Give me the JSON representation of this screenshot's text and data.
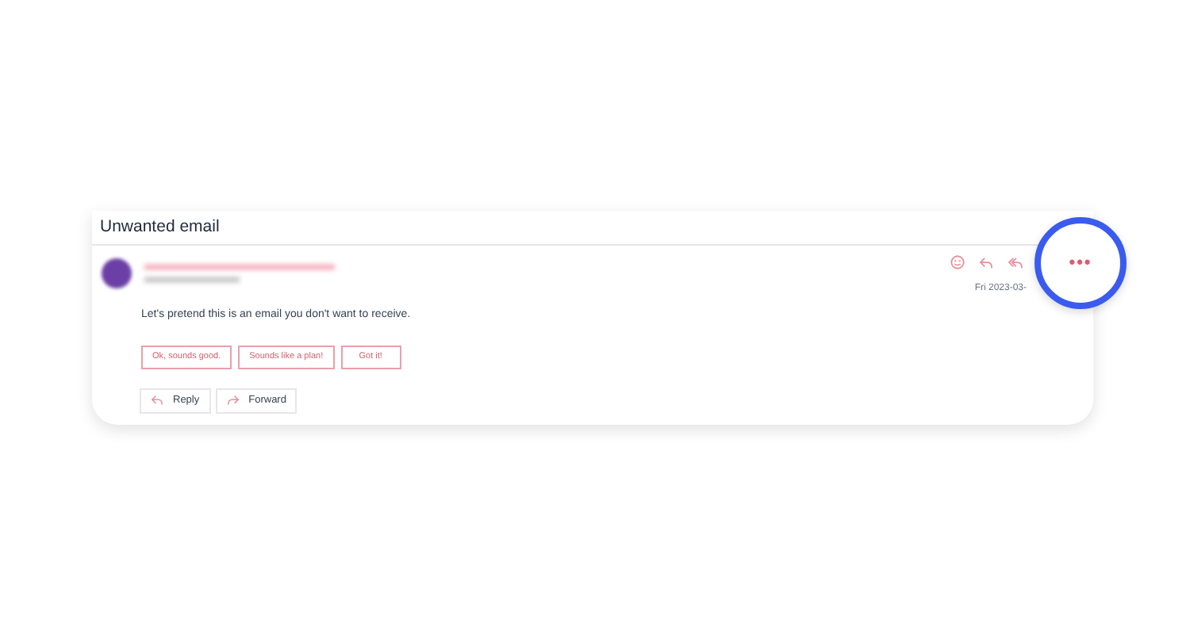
{
  "conversation": {
    "title": "Unwanted email"
  },
  "message": {
    "date": "Fri 2023-03-",
    "body": "Let's pretend this is an email you don't want to receive.",
    "suggested_replies": [
      "Ok, sounds good.",
      "Sounds like a plan!",
      "Got it!"
    ],
    "actions": [
      {
        "kind": "reply",
        "label": "Reply"
      },
      {
        "kind": "forward",
        "label": "Forward"
      }
    ]
  },
  "more_button": {
    "label": "•••",
    "highlighted": true
  }
}
